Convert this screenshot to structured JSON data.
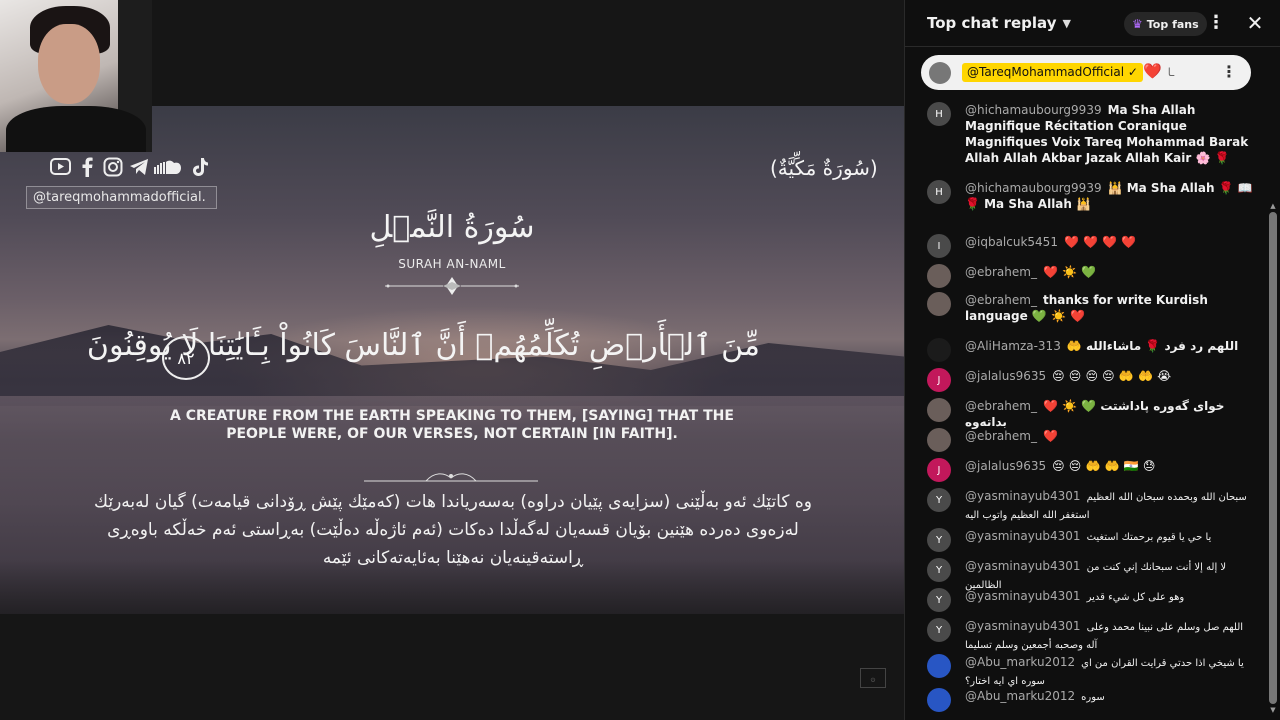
{
  "video": {
    "social_icons": [
      "youtube-icon",
      "facebook-icon",
      "instagram-icon",
      "telegram-icon",
      "soundcloud-icon",
      "tiktok-icon"
    ],
    "handle": "@tareqmohammadofficial.",
    "surah_type_ar": "(سُورَةٌ مَكِّيَّةٌ)",
    "surah_name_ar": "سُورَةُ النَّمۡلِ",
    "surah_name_en": "SURAH AN-NAML",
    "verse_ar": "مِّنَ ٱلۡأَرۡضِ تُكَلِّمُهُمۡ أَنَّ ٱلنَّاسَ كَانُواْ بِـَٔايَٰتِنَا لَا يُوقِنُونَ",
    "verse_number": "٨٢",
    "verse_en": "A CREATURE FROM THE EARTH SPEAKING TO THEM, [SAYING] THAT THE PEOPLE WERE, OF OUR VERSES, NOT CERTAIN [IN FAITH].",
    "verse_ku": [
      "وە کاتێك ئەو بەڵێنی (سزایەی پێیان دراوە) بەسەریاندا هات (کەمێك پێش ڕۆدانی قیامەت) گیان لەبەرێك",
      "لەزەوی دەردە هێنین بۆیان قسەیان لەگەڵدا دەکات (ئەم ئاژەڵە دەڵێت) بەڕاستی ئەم خەڵکە باوەڕی",
      "ڕاستەقینەیان نەهێنا بەئایەتەکانی ئێمە"
    ]
  },
  "chat": {
    "title": "Top chat replay",
    "top_fans_label": "Top fans",
    "pinned": {
      "author": "@TareqMohammadOfficial ✓",
      "message": "❤️",
      "suffix": "ـا"
    },
    "messages": [
      {
        "avatar_letter": "H",
        "avatar_color": "#4a4a4a",
        "author": "@hichamaubourg9939",
        "text": "Ma Sha Allah Magnifique Récitation Coranique Magnifiques Voix Tareq Mohammad Barak Allah Allah Akbar Jazak Allah Kair 🌸 🌹",
        "rtl": false
      },
      {
        "avatar_letter": "H",
        "avatar_color": "#4a4a4a",
        "author": "@hichamaubourg9939",
        "text": "🕌 Ma Sha Allah 🌹 📖 🌹 Ma Sha Allah 🕌",
        "rtl": false
      },
      {
        "avatar_letter": "I",
        "avatar_color": "#4a4a4a",
        "author": "@iqbalcuk5451",
        "text": "❤️ ❤️ ❤️ ❤️",
        "rtl": false
      },
      {
        "avatar_letter": "",
        "avatar_color": "#6a5e5a",
        "author": "@ebrahem_",
        "text": "❤️ ☀️ 💚",
        "rtl": false
      },
      {
        "avatar_letter": "",
        "avatar_color": "#6a5e5a",
        "author": "@ebrahem_",
        "text": "thanks for write Kurdish language 💚 ☀️ ❤️",
        "rtl": false
      },
      {
        "avatar_letter": "",
        "avatar_color": "#1b1b1b",
        "author": "@AliHamza-313",
        "text": "🤲 اللهم رد فرد 🌹 ماشاءالله",
        "rtl": false
      },
      {
        "avatar_letter": "J",
        "avatar_color": "#c2185b",
        "author": "@jalalus9635",
        "text": "😔 😔 😔 😔 🤲 🤲 😭",
        "rtl": false
      },
      {
        "avatar_letter": "",
        "avatar_color": "#6a5e5a",
        "author": "@ebrahem_",
        "text": "❤️ ☀️ 💚 خوای گەورە پاداشتت بداتەوە",
        "rtl": false
      },
      {
        "avatar_letter": "",
        "avatar_color": "#6a5e5a",
        "author": "@ebrahem_",
        "text": "❤️",
        "rtl": false
      },
      {
        "avatar_letter": "J",
        "avatar_color": "#c2185b",
        "author": "@jalalus9635",
        "text": "😔 😔 🤲 🤲 🇮🇳 😓",
        "rtl": false
      },
      {
        "avatar_letter": "Y",
        "avatar_color": "#4a4a4a",
        "author": "@yasminayub4301",
        "text": "سبحان الله وبحمده سبحان الله العظيم استغفر الله العظيم واتوب اليه",
        "rtl": true
      },
      {
        "avatar_letter": "Y",
        "avatar_color": "#4a4a4a",
        "author": "@yasminayub4301",
        "text": "يا حي يا قيوم برحمتك استغيث",
        "rtl": true
      },
      {
        "avatar_letter": "Y",
        "avatar_color": "#4a4a4a",
        "author": "@yasminayub4301",
        "text": "لا إله إلا أنت سبحانك إني كنت من الظالمين",
        "rtl": true
      },
      {
        "avatar_letter": "Y",
        "avatar_color": "#4a4a4a",
        "author": "@yasminayub4301",
        "text": "وهو على كل شيء قدير",
        "rtl": true
      },
      {
        "avatar_letter": "Y",
        "avatar_color": "#4a4a4a",
        "author": "@yasminayub4301",
        "text": "اللهم صل وسلم على نبينا محمد وعلى آله وصحبه أجمعين وسلم تسليما",
        "rtl": true
      },
      {
        "avatar_letter": "",
        "avatar_color": "#2856c4",
        "author": "@Abu_marku2012",
        "text": "يا شيخي اذا حدتي قرايت القران من اي سوره اي ايه اختار؟",
        "rtl": true
      },
      {
        "avatar_letter": "",
        "avatar_color": "#2856c4",
        "author": "@Abu_marku2012",
        "text": "سوره",
        "rtl": true
      }
    ]
  }
}
